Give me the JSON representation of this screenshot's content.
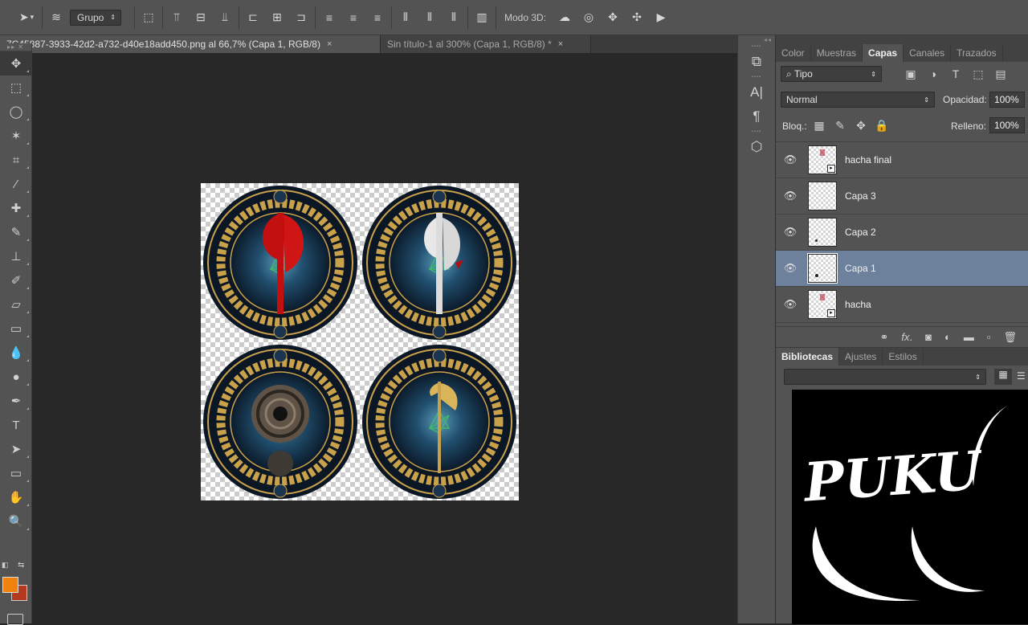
{
  "options_bar": {
    "auto_select_dropdown": "Grupo",
    "mode3d_label": "Modo 3D:"
  },
  "doc_tabs": [
    {
      "label": "7C45887-3933-42d2-a732-d40e18add450.png al 66,7% (Capa 1, RGB/8)",
      "close": "×"
    },
    {
      "label": "Sin título-1 al 300% (Capa 1, RGB/8) *",
      "close": "×"
    }
  ],
  "tools": [
    {
      "icon": "move-icon",
      "glyph": "✥"
    },
    {
      "icon": "marquee-icon",
      "glyph": "⬚"
    },
    {
      "icon": "lasso-icon",
      "glyph": "◯"
    },
    {
      "icon": "magic-wand-icon",
      "glyph": "✶"
    },
    {
      "icon": "crop-icon",
      "glyph": "⌗"
    },
    {
      "icon": "eyedropper-icon",
      "glyph": "⁄"
    },
    {
      "icon": "healing-brush-icon",
      "glyph": "✚"
    },
    {
      "icon": "brush-icon",
      "glyph": "✎"
    },
    {
      "icon": "stamp-icon",
      "glyph": "⊥"
    },
    {
      "icon": "history-brush-icon",
      "glyph": "✐"
    },
    {
      "icon": "eraser-icon",
      "glyph": "▱"
    },
    {
      "icon": "gradient-icon",
      "glyph": "▭"
    },
    {
      "icon": "blur-icon",
      "glyph": "💧"
    },
    {
      "icon": "dodge-icon",
      "glyph": "●"
    },
    {
      "icon": "pen-icon",
      "glyph": "✒"
    },
    {
      "icon": "type-icon",
      "glyph": "T"
    },
    {
      "icon": "path-selection-icon",
      "glyph": "➤"
    },
    {
      "icon": "rectangle-icon",
      "glyph": "▭"
    },
    {
      "icon": "hand-icon",
      "glyph": "✋"
    },
    {
      "icon": "zoom-icon",
      "glyph": "🔍"
    }
  ],
  "colors": {
    "foreground": "#f0820f",
    "background": "#b5391f",
    "selected_layer": "#6d819d"
  },
  "panel_tabs": [
    "Color",
    "Muestras",
    "Capas",
    "Canales",
    "Trazados"
  ],
  "active_panel_tab": "Capas",
  "layer_filter": "Tipo",
  "blend_mode": "Normal",
  "opacity_label": "Opacidad:",
  "opacity_value": "100%",
  "lock_label": "Bloq.:",
  "fill_label": "Relleno:",
  "fill_value": "100%",
  "layers": [
    {
      "name": "hacha final",
      "visible": true,
      "selected": false
    },
    {
      "name": "Capa 3",
      "visible": true,
      "selected": false
    },
    {
      "name": "Capa 2",
      "visible": true,
      "selected": false
    },
    {
      "name": "Capa 1",
      "visible": true,
      "selected": true
    },
    {
      "name": "hacha",
      "visible": true,
      "selected": false
    }
  ],
  "library_tabs": [
    "Bibliotecas",
    "Ajustes",
    "Estilos"
  ],
  "library_preview_text": "PUKU"
}
